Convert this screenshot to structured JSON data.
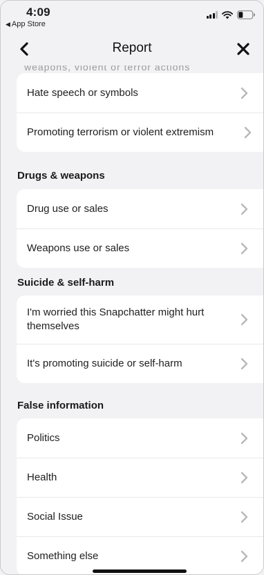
{
  "status_bar": {
    "time": "4:09",
    "back_app": "App Store"
  },
  "nav": {
    "title": "Report",
    "back_icon": "chevron-left-icon",
    "close_icon": "close-icon"
  },
  "ghost_text": "weapons, violent or terror actions",
  "groups": [
    {
      "header": "",
      "items": [
        "Hate speech or symbols",
        "Promoting terrorism or violent extremism"
      ]
    },
    {
      "header": "Drugs & weapons",
      "items": [
        "Drug use or sales",
        "Weapons use or sales"
      ]
    },
    {
      "header": "Suicide & self-harm",
      "items": [
        "I'm worried this Snapchatter might hurt themselves",
        "It's promoting suicide or self-harm"
      ]
    },
    {
      "header": "False information",
      "items": [
        "Politics",
        "Health",
        "Social Issue",
        "Something else"
      ]
    }
  ],
  "colors": {
    "background": "#f2f2f4",
    "card": "#ffffff",
    "chevron": "#b8b8bc",
    "divider": "#e8e8ea"
  }
}
